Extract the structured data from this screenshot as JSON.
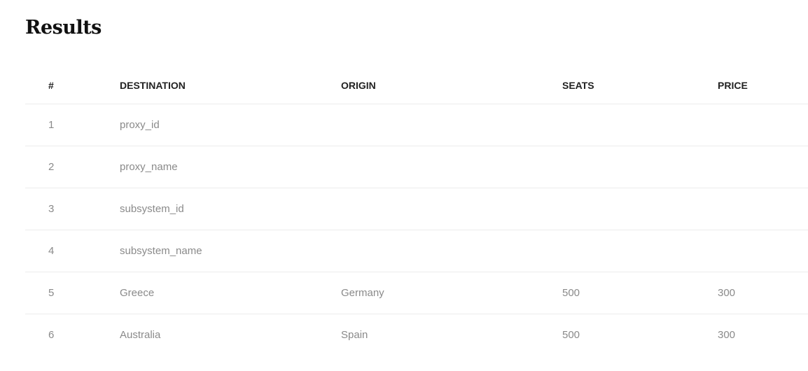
{
  "page": {
    "title": "Results"
  },
  "table": {
    "headers": {
      "num": "#",
      "destination": "DESTINATION",
      "origin": "ORIGIN",
      "seats": "SEATS",
      "price": "PRICE"
    },
    "rows": [
      {
        "num": "1",
        "destination": "proxy_id",
        "origin": "",
        "seats": "",
        "price": ""
      },
      {
        "num": "2",
        "destination": "proxy_name",
        "origin": "",
        "seats": "",
        "price": ""
      },
      {
        "num": "3",
        "destination": "subsystem_id",
        "origin": "",
        "seats": "",
        "price": ""
      },
      {
        "num": "4",
        "destination": "subsystem_name",
        "origin": "",
        "seats": "",
        "price": ""
      },
      {
        "num": "5",
        "destination": "Greece",
        "origin": "Germany",
        "seats": "500",
        "price": "300"
      },
      {
        "num": "6",
        "destination": "Australia",
        "origin": "Spain",
        "seats": "500",
        "price": "300"
      }
    ]
  },
  "colors": {
    "header_text": "#222222",
    "cell_text": "#8a8a8a",
    "divider": "#ececec"
  }
}
